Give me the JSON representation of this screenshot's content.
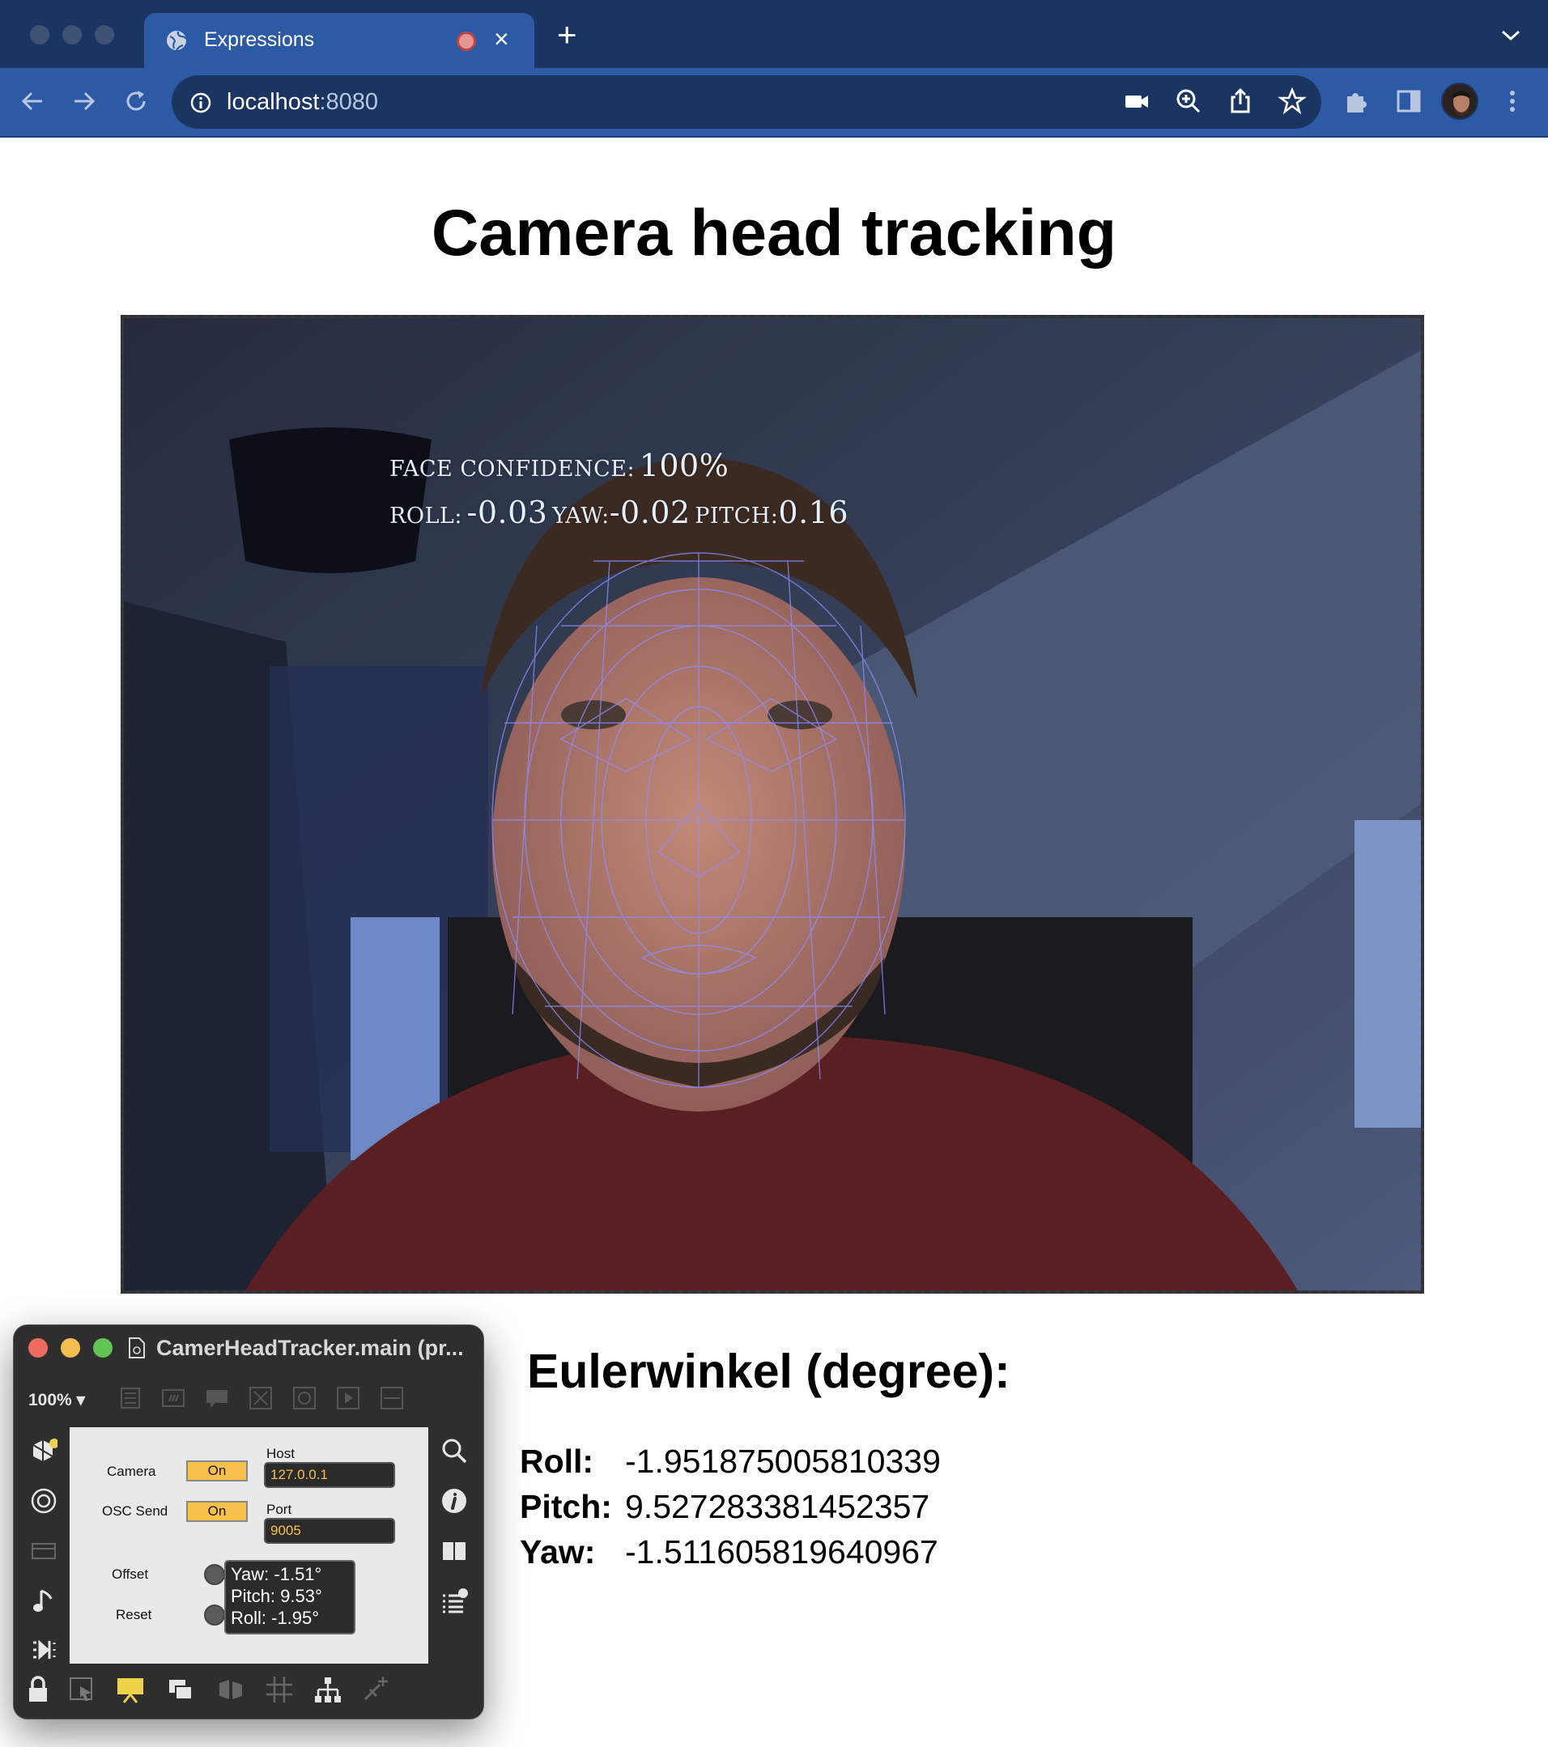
{
  "browser": {
    "tab_title": "Expressions",
    "url_host": "localhost",
    "url_port": ":8080",
    "icons": [
      "globe-icon",
      "recording-icon",
      "close-icon",
      "new-tab-icon",
      "tab-list-icon",
      "back-icon",
      "forward-icon",
      "reload-icon",
      "site-info-icon",
      "camera-icon",
      "zoom-icon",
      "share-icon",
      "bookmark-star-icon",
      "extensions-icon",
      "side-panel-icon",
      "profile-avatar",
      "menu-icon"
    ],
    "colors": {
      "tabbar": "#1b3563",
      "toolbar": "#2c5aa5"
    }
  },
  "page": {
    "title": "Camera head tracking",
    "video_overlay": {
      "confidence_label": "FACE CONFIDENCE:",
      "confidence_value": "100%",
      "roll_label": "ROLL:",
      "roll_value": "-0.03",
      "yaw_label": "YAW:",
      "yaw_value": "-0.02",
      "pitch_label": "PITCH:",
      "pitch_value": "0.16"
    },
    "euler": {
      "heading": "Eulerwinkel (degree):",
      "rows": [
        {
          "label": "Roll:",
          "value": "-1.951875005810339"
        },
        {
          "label": "Pitch:",
          "value": "9.527283381452357"
        },
        {
          "label": "Yaw:",
          "value": "-1.511605819640967"
        }
      ]
    }
  },
  "max_window": {
    "title": "CamerHeadTracker.main (pr...",
    "zoom": "100%",
    "camera_label": "Camera",
    "camera_toggle": "On",
    "osc_label": "OSC Send",
    "osc_toggle": "On",
    "host_label": "Host",
    "host_value": "127.0.0.1",
    "port_label": "Port",
    "port_value": "9005",
    "offset_label": "Offset",
    "reset_label": "Reset",
    "readout": {
      "yaw": "Yaw: -1.51°",
      "pitch": "Pitch: 9.53°",
      "roll": "Roll: -1.95°"
    },
    "colors": {
      "toggle": "#f6c04b",
      "field_text": "#f6c04b"
    }
  }
}
